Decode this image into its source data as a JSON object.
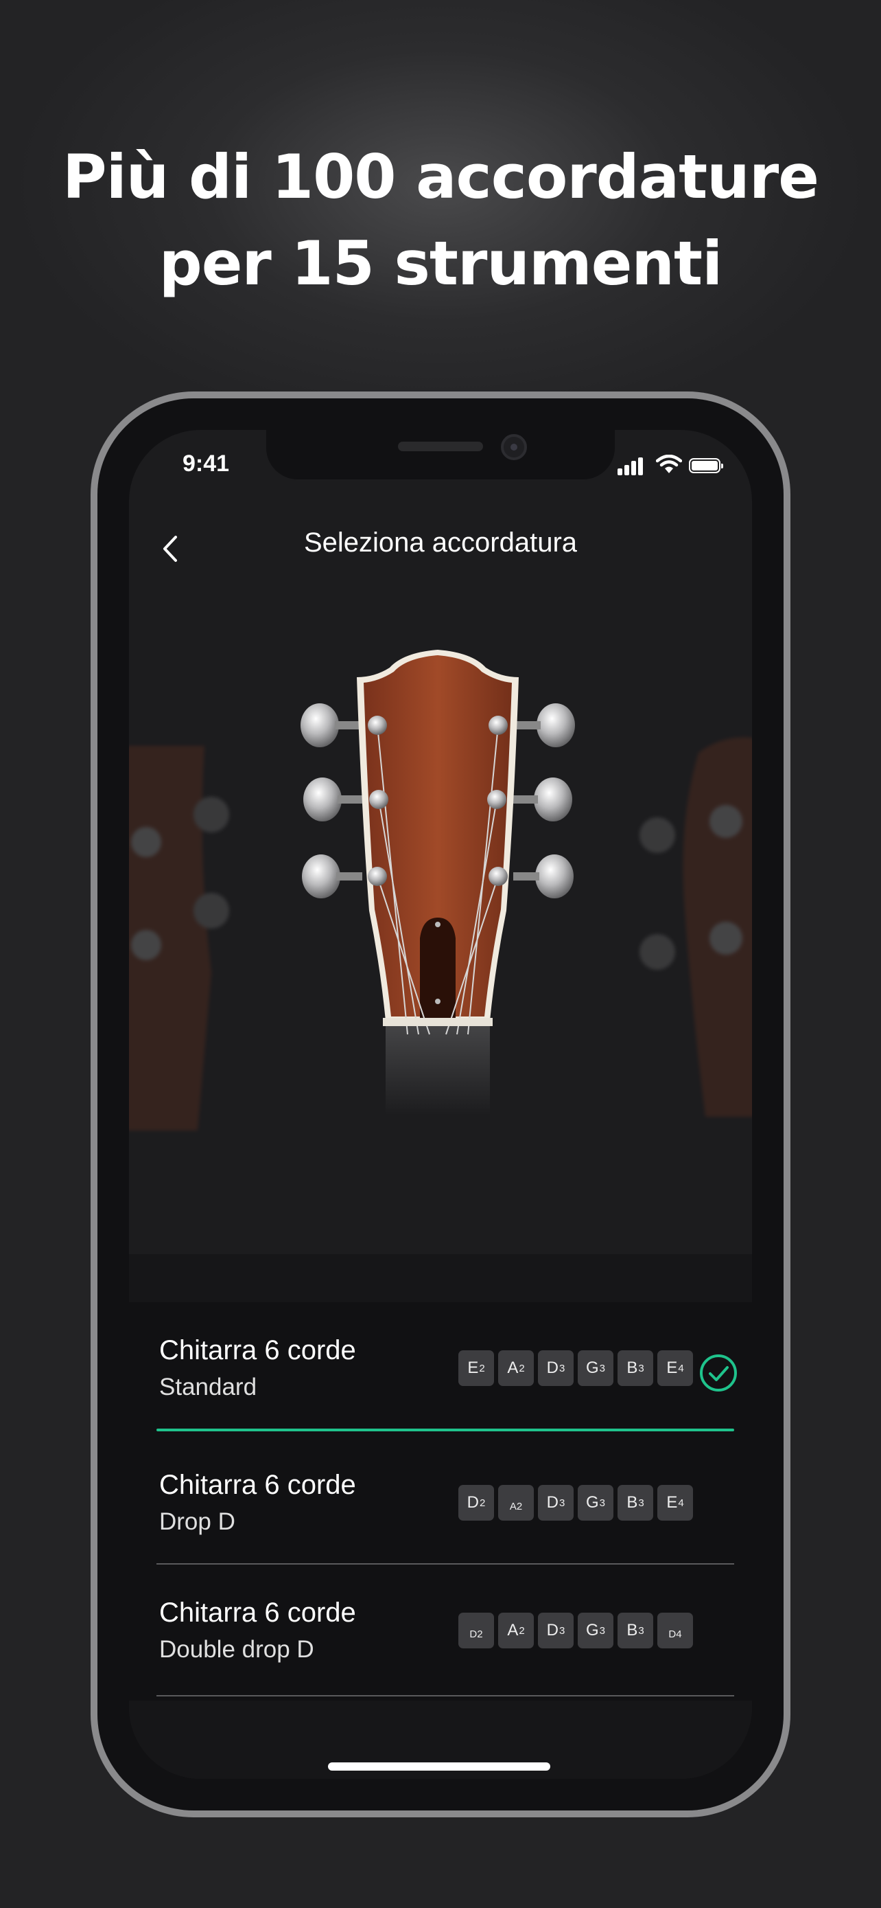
{
  "headline": {
    "line1": "Più di 100 accordature",
    "line2": "per 15 strumenti"
  },
  "status_bar": {
    "time": "9:41",
    "icons": [
      "signal-icon",
      "wifi-icon",
      "battery-icon"
    ]
  },
  "nav": {
    "title": "Seleziona accordatura",
    "back_icon": "chevron-left-icon"
  },
  "tunings": [
    {
      "instrument": "Chitarra 6 corde",
      "name": "Standard",
      "selected": true,
      "notes": [
        {
          "n": "E",
          "o": "2"
        },
        {
          "n": "A",
          "o": "2"
        },
        {
          "n": "D",
          "o": "3"
        },
        {
          "n": "G",
          "o": "3"
        },
        {
          "n": "B",
          "o": "3"
        },
        {
          "n": "E",
          "o": "4"
        }
      ]
    },
    {
      "instrument": "Chitarra 6 corde",
      "name": "Drop D",
      "selected": false,
      "notes": [
        {
          "n": "D",
          "o": "2"
        },
        {
          "n": "A2",
          "o": "",
          "small": true
        },
        {
          "n": "D",
          "o": "3"
        },
        {
          "n": "G",
          "o": "3"
        },
        {
          "n": "B",
          "o": "3"
        },
        {
          "n": "E",
          "o": "4"
        }
      ]
    },
    {
      "instrument": "Chitarra 6 corde",
      "name": "Double drop D",
      "selected": false,
      "notes": [
        {
          "n": "D2",
          "o": "",
          "small": true
        },
        {
          "n": "A",
          "o": "2"
        },
        {
          "n": "D",
          "o": "3"
        },
        {
          "n": "G",
          "o": "3"
        },
        {
          "n": "B",
          "o": "3"
        },
        {
          "n": "D4",
          "o": "",
          "small": true
        }
      ]
    }
  ],
  "colors": {
    "accent": "#1fc38c",
    "chip": "#3d3d40",
    "background": "#1c1c1e"
  }
}
